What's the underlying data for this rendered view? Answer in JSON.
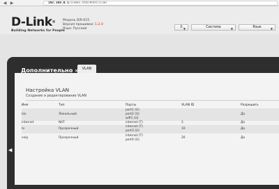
{
  "browser": {
    "address_host": "192.168.0.1",
    "address_path": "/index.html#net/vlan"
  },
  "header": {
    "logo_text": "D-Link",
    "logo_tagline": "Building Networks for People",
    "model_line": "Модель DIR-615",
    "firmware_label": "Версия прошивки:",
    "firmware_value": "1.2.0",
    "lang_line": "Язык: Русский",
    "system_label": "Система",
    "language_label": "Язык"
  },
  "section": {
    "title": "Дополнительно »",
    "tab": "VLAN"
  },
  "content": {
    "title": "Настройка VLAN",
    "subtitle": "Создание и редактирование VLAN"
  },
  "table": {
    "headers": [
      "Имя",
      "Тип",
      "Порты",
      "VLAN ID",
      "Разрешить"
    ],
    "rows": [
      {
        "name": "lan",
        "type": "Локальный",
        "ports": [
          "port1 (U)",
          "port2 (U)",
          "wifi1 (U)"
        ],
        "vlan_id": "",
        "enabled": "Да"
      },
      {
        "name": "internet",
        "type": "NAT",
        "ports": [
          "internet (T)"
        ],
        "vlan_id": "2",
        "enabled": "Да"
      },
      {
        "name": "tv",
        "type": "Прозрачный",
        "ports": [
          "internet (T)",
          "port3 (U)"
        ],
        "vlan_id": "10",
        "enabled": "Да"
      },
      {
        "name": "voip",
        "type": "Прозрачный",
        "ports": [
          "internet (T)",
          "port4 (U)"
        ],
        "vlan_id": "20",
        "enabled": "Да"
      }
    ]
  }
}
